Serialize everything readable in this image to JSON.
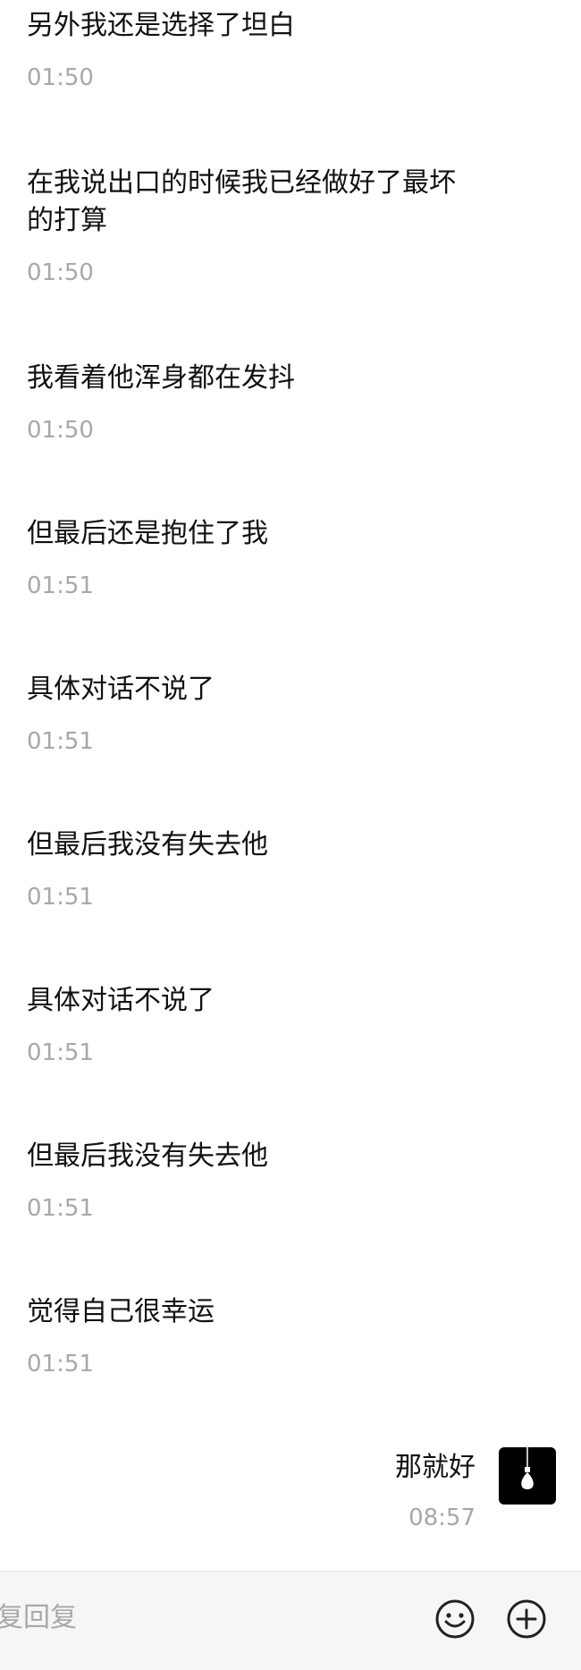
{
  "messages": [
    {
      "text": "另外我还是选择了坦白",
      "time": "01:50"
    },
    {
      "text": "在我说出口的时候我已经做好了最坏\n的打算",
      "time": "01:50"
    },
    {
      "text": "我看着他浑身都在发抖",
      "time": "01:50"
    },
    {
      "text": "但最后还是抱住了我",
      "time": "01:51"
    },
    {
      "text": "具体对话不说了",
      "time": "01:51"
    },
    {
      "text": "但最后我没有失去他",
      "time": "01:51"
    },
    {
      "text": "具体对话不说了",
      "time": "01:51"
    },
    {
      "text": "但最后我没有失去他",
      "time": "01:51"
    },
    {
      "text": "觉得自己很幸运",
      "time": "01:51"
    }
  ],
  "my_message": {
    "text": "那就好",
    "time": "08:57"
  },
  "input_bar": {
    "placeholder": "复回复",
    "emoji_icon": "smiley-face-icon",
    "plus_icon": "plus-circle-icon"
  },
  "colors": {
    "text": "#111111",
    "time": "#a8a8a8",
    "avatar_bg": "#000000",
    "bar_bg": "#f6f6f8"
  }
}
